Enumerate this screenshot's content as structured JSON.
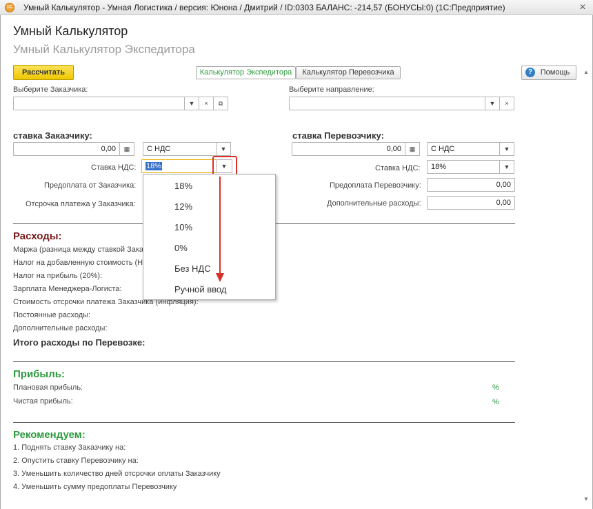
{
  "window": {
    "title": "Умный Калькулятор - Умная Логистика / версия: Юнона / Дмитрий / ID:0303 БАЛАНС: -214,57 (БОНУСЫ:0)  (1С:Предприятие)",
    "app_icon": "1С"
  },
  "form": {
    "title": "Умный Калькулятор",
    "subtitle": "Умный Калькулятор Экспедитора"
  },
  "toolbar": {
    "calc_label": "Рассчитать",
    "tab_forwarder": "Калькулятор Экспедитора",
    "tab_carrier": "Калькулятор Перевозчика",
    "help_label": "Помощь"
  },
  "customer": {
    "label": "Выберите Заказчика:",
    "value": ""
  },
  "direction": {
    "label": "Выберите направление:",
    "value": ""
  },
  "left": {
    "heading": "ставка Заказчику:",
    "rate_value": "0,00",
    "vat_mode": "С НДС",
    "vat_label": "Ставка НДС:",
    "vat_value": "18%",
    "prepay_label": "Предоплата от Заказчика:",
    "delay_label": "Отсрочка платежа у Заказчика:"
  },
  "right": {
    "heading": "ставка Перевозчику:",
    "rate_value": "0,00",
    "vat_mode": "С НДС",
    "vat_label": "Ставка НДС:",
    "vat_value": "18%",
    "prepay_label": "Предоплата Перевозчику:",
    "prepay_value": "0,00",
    "extra_label": "Дополнительные расходы:",
    "extra_value": "0,00"
  },
  "expenses": {
    "heading": "Расходы:",
    "rows": [
      "Маржа (разница между ставкой Зака",
      "Налог на добавленную стоимость (Н,",
      "Налог на прибыль (20%):",
      "Зарплата Менеджера-Логиста:",
      "Стоимость отсрочки платежа Заказчика (инфляция):",
      "Постоянные расходы:",
      "Дополнительные расходы:"
    ],
    "total": "Итого расходы по Перевозке:"
  },
  "profit": {
    "heading": "Прибыль:",
    "planned": "Плановая прибыль:",
    "net": "Чистая прибыль:",
    "pct": "%"
  },
  "recommend": {
    "heading": "Рекомендуем:",
    "items": [
      "1. Поднять ставку Заказчику на:",
      "2. Опустить ставку Перевозчику на:",
      "3. Уменьшить количество дней отсрочки оплаты Заказчику",
      "4. Уменьшить сумму предоплаты Перевозчику"
    ]
  },
  "dropdown": {
    "options": [
      "18%",
      "12%",
      "10%",
      "0%",
      "Без НДС",
      "Ручной ввод"
    ]
  },
  "colors": {
    "accent_green": "#2e9a3e",
    "heading_red": "#7a1a1a",
    "annotation_red": "#d9302a",
    "button_yellow": "#f5d21e"
  }
}
